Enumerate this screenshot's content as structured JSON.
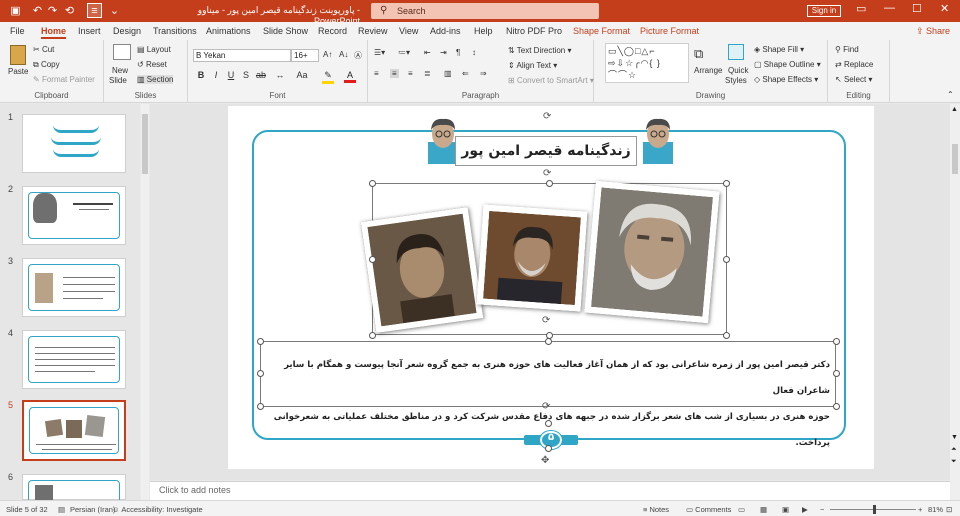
{
  "window": {
    "title": "پاورپوینت زندگینامه قیصر امین پور - میناوو",
    "app": "PowerPoint",
    "search_placeholder": "Search",
    "sign_in": "Sign in",
    "icons": [
      "save-icon",
      "undo-icon",
      "redo-icon",
      "restart-icon",
      "format-painter-icon",
      "minimize-icon",
      "maximize-icon",
      "close-icon"
    ]
  },
  "menu": {
    "tabs": [
      "File",
      "Home",
      "Insert",
      "Design",
      "Transitions",
      "Animations",
      "Slide Show",
      "Record",
      "Review",
      "View",
      "Add-ins",
      "Help",
      "Nitro PDF Pro"
    ],
    "context_tabs": [
      "Shape Format",
      "Picture Format"
    ],
    "active": "Home",
    "share": "Share"
  },
  "ribbon": {
    "clipboard": {
      "label": "Clipboard",
      "paste": "Paste",
      "cut": "Cut",
      "copy": "Copy",
      "format_painter": "Format Painter"
    },
    "slides": {
      "label": "Slides",
      "new_slide": "New",
      "new_slide2": "Slide",
      "layout": "Layout",
      "reset": "Reset",
      "section": "Section"
    },
    "font": {
      "label": "Font",
      "family": "B Yekan",
      "size": "16+",
      "bold": "B",
      "italic": "I",
      "underline": "U",
      "strike": "S",
      "shadow": "ab",
      "aa": "Aa"
    },
    "paragraph": {
      "label": "Paragraph",
      "text_direction": "Text Direction",
      "align_text": "Align Text",
      "smartart": "Convert to SmartArt"
    },
    "drawing": {
      "label": "Drawing",
      "arrange": "Arrange",
      "quick_styles": "Quick",
      "quick_styles2": "Styles",
      "shape_fill": "Shape Fill",
      "shape_outline": "Shape Outline",
      "shape_effects": "Shape Effects"
    },
    "editing": {
      "label": "Editing",
      "find": "Find",
      "replace": "Replace",
      "select": "Select"
    }
  },
  "thumbnails": [
    {
      "num": "1",
      "selected": false
    },
    {
      "num": "2",
      "selected": false
    },
    {
      "num": "3",
      "selected": false
    },
    {
      "num": "4",
      "selected": false
    },
    {
      "num": "5",
      "selected": true
    },
    {
      "num": "6",
      "selected": false
    }
  ],
  "slide": {
    "title": "زندگینامه قیصر امین پور",
    "line1": "دکتر قیصر امین پور از زمره شاعرانی بود که از همان آغاز فعالیت های حوزه هنری به جمع گروه شعر آنجا پیوست و همگام با سایر شاعران فعال",
    "line2": "حوزه هنری در بسیاری از شب های شعر برگزار شده در جبهه های دفاع مقدس شرکت کرد و در مناطق مختلف عملیاتی به شعرخوانی پرداخت.",
    "page_number": "۵"
  },
  "notes_placeholder": "Click to add notes",
  "status": {
    "slide_info": "Slide 5 of 32",
    "language": "Persian (Iran)",
    "accessibility": "Accessibility: Investigate",
    "notes": "Notes",
    "comments": "Comments",
    "zoom": "81%"
  },
  "colors": {
    "accent": "#c43e1c",
    "frame": "#30a6c7"
  }
}
